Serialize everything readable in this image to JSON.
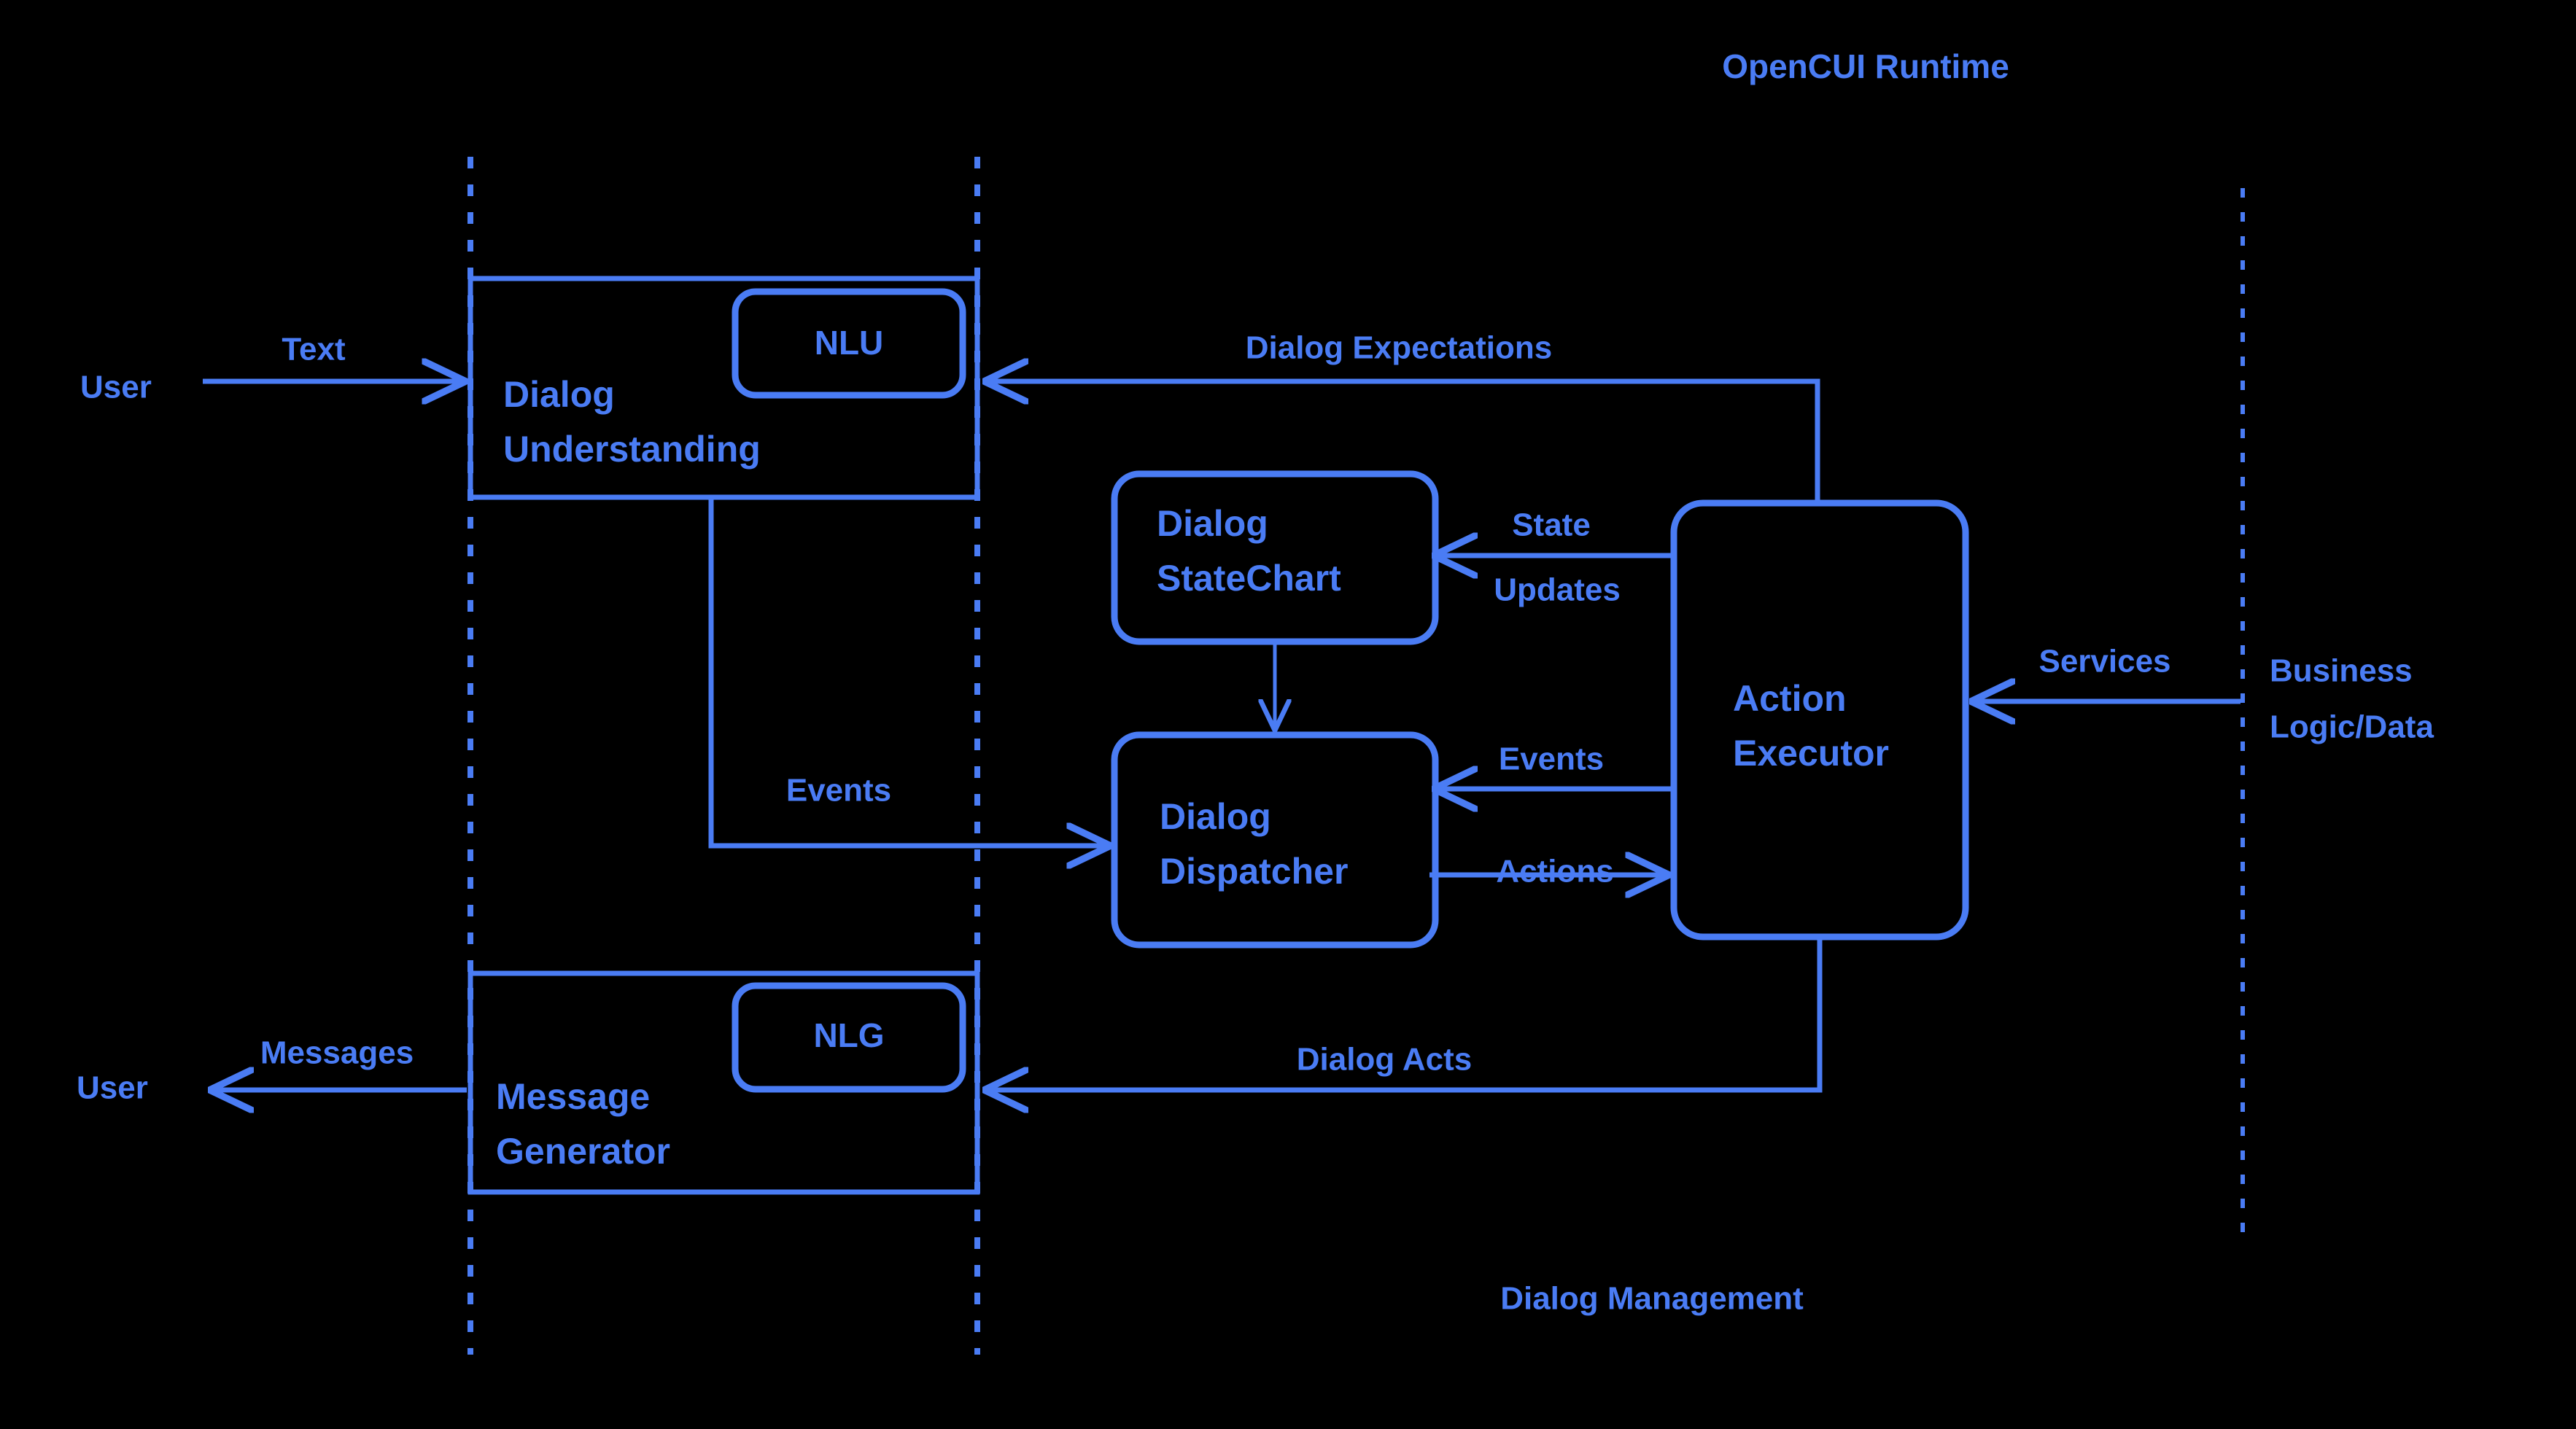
{
  "title": "OpenCUI Runtime",
  "accent_color": "#4a7cf4",
  "background_color": "#000000",
  "zones": {
    "dialog_management": "Dialog Management"
  },
  "actors": {
    "user_in": "User",
    "user_out": "User",
    "business": {
      "line1": "Business",
      "line2": "Logic/Data"
    }
  },
  "boxes": {
    "dialog_understanding": {
      "line1": "Dialog",
      "line2": "Understanding",
      "sub": "NLU"
    },
    "message_generator": {
      "line1": "Message",
      "line2": "Generator",
      "sub": "NLG"
    },
    "dialog_statechart": {
      "line1": "Dialog",
      "line2": "StateChart"
    },
    "dialog_dispatcher": {
      "line1": "Dialog",
      "line2": "Dispatcher"
    },
    "action_executor": {
      "line1": "Action",
      "line2": "Executor"
    }
  },
  "edges": {
    "text": "Text",
    "messages": "Messages",
    "dialog_expectations": "Dialog  Expectations",
    "events_left": "Events",
    "events_right": "Events",
    "actions": "Actions",
    "state_updates": {
      "line1": "State",
      "line2": "Updates"
    },
    "dialog_acts": "Dialog Acts",
    "services": "Services"
  }
}
